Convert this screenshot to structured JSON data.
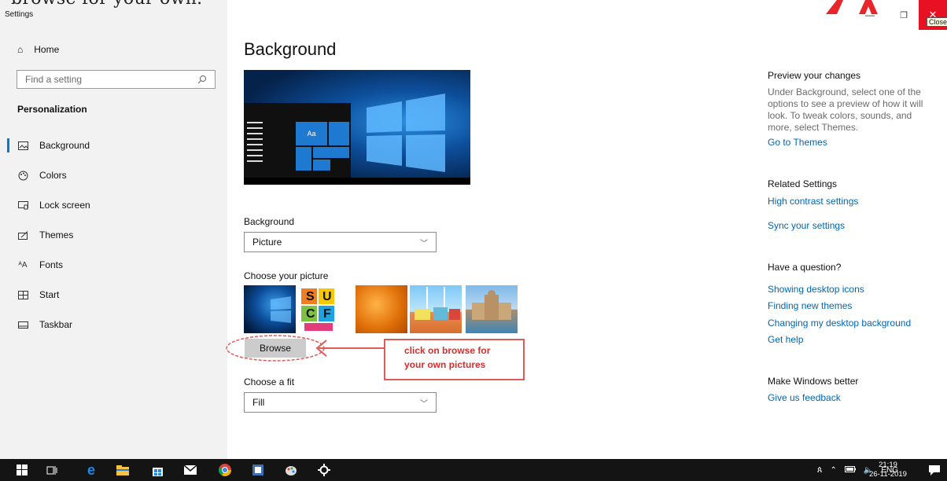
{
  "overlay": {
    "caption": "browse for your own."
  },
  "window": {
    "title": "Settings",
    "minimize_glyph": "—",
    "restore_glyph": "❐",
    "close_glyph": "✕",
    "close_tooltip": "Close"
  },
  "sidebar": {
    "home_label": "Home",
    "search_placeholder": "Find a setting",
    "section_title": "Personalization",
    "items": [
      {
        "label": "Background",
        "icon": "picture-icon",
        "active": true
      },
      {
        "label": "Colors",
        "icon": "palette-icon",
        "active": false
      },
      {
        "label": "Lock screen",
        "icon": "lock-screen-icon",
        "active": false
      },
      {
        "label": "Themes",
        "icon": "brush-icon",
        "active": false
      },
      {
        "label": "Fonts",
        "icon": "font-icon",
        "active": false
      },
      {
        "label": "Start",
        "icon": "start-icon",
        "active": false
      },
      {
        "label": "Taskbar",
        "icon": "taskbar-icon",
        "active": false
      }
    ],
    "accent_color": "#0078d7"
  },
  "main": {
    "title": "Background",
    "preview_tile_label": "Aa",
    "background_label": "Background",
    "background_value": "Picture",
    "choose_picture_label": "Choose your picture",
    "thumbnail_letters": [
      "S",
      "U",
      "C",
      "F"
    ],
    "browse_label": "Browse",
    "callout_line1": "click on browse for",
    "callout_line2": "your own pictures",
    "choose_fit_label": "Choose a fit",
    "fit_value": "Fill"
  },
  "right": {
    "preview_heading": "Preview your changes",
    "preview_text": "Under Background, select one of the options to see a preview of how it will look. To tweak colors, sounds, and more, select Themes.",
    "go_to_themes": "Go to Themes",
    "related_heading": "Related Settings",
    "high_contrast": "High contrast settings",
    "sync_settings": "Sync your settings",
    "question_heading": "Have a question?",
    "links": [
      "Showing desktop icons",
      "Finding new themes",
      "Changing my desktop background",
      "Get help"
    ],
    "better_heading": "Make Windows better",
    "feedback": "Give us feedback",
    "link_color": "#0066b4"
  },
  "taskbar": {
    "language": "ENG",
    "time": "21:19",
    "date": "26-11-2019"
  }
}
